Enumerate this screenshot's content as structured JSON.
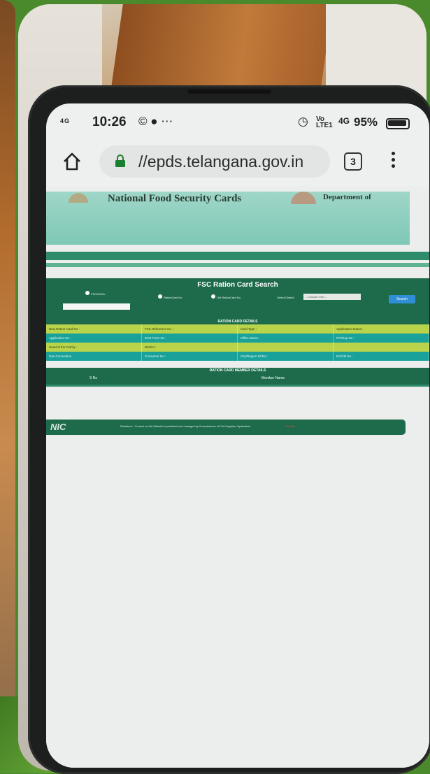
{
  "status_bar": {
    "signal": "4G",
    "time": "10:26",
    "notification_icons": "© ● ⋯",
    "alarm_icon": "alarm-clock",
    "volte_line1": "Vo",
    "volte_line2": "LTE1",
    "network": "4G",
    "battery": "95%"
  },
  "browser": {
    "url": "//epds.telangana.gov.in",
    "tab_count": "3"
  },
  "page": {
    "banner_title": "National Food Security Cards",
    "banner_dept": "Department of",
    "search": {
      "title": "FSC Ration Card Search",
      "options": [
        "FSC/RefNo",
        "RationCard No",
        "Old RationCard No"
      ],
      "select_label": "Select District",
      "district_value": "-- Choose One --",
      "button": "Search"
    },
    "details": {
      "header": "RATION CARD DETAILS",
      "rows": [
        [
          "New Ration Card No :",
          "FSC Reference No. :",
          "Card Type :",
          "Application Status :"
        ],
        [
          "Application No :",
          "EKG Form No :",
          "Office Name :",
          "FPShop No :"
        ],
        [
          "Head of the Family :",
          "District :",
          "",
          ""
        ],
        [
          "Gas Connection",
          "Consumer No :",
          "City/Region SCNo :",
          "DA/CN No :"
        ]
      ]
    },
    "members": {
      "header": "RATION CARD MEMBER DETAILS",
      "col_sno": "S No",
      "col_name": "Member Name"
    },
    "footer": {
      "logo": "NIC",
      "disclaimer": "Disclaimer : Content on this Website is published and managed by Commissioner of Civil Supplies, Hyderabad.",
      "link": "Website"
    }
  }
}
